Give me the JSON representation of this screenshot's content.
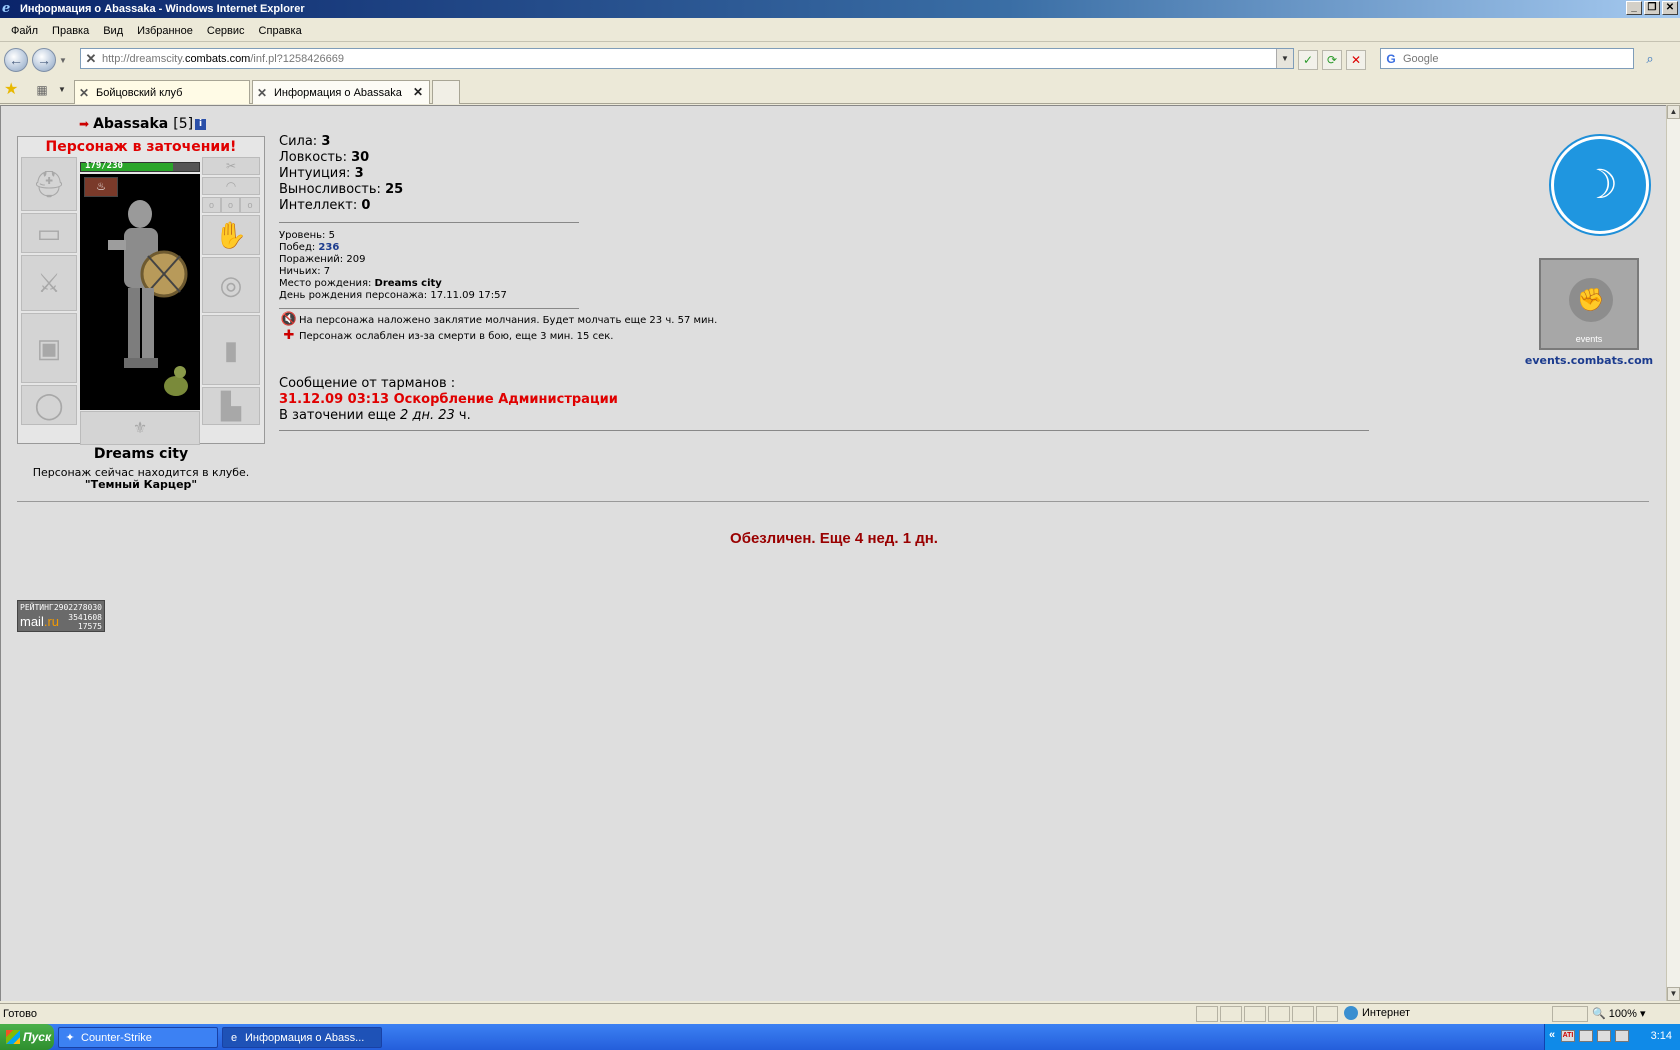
{
  "window": {
    "title": "Информация о Abassaka - Windows Internet Explorer",
    "min": "_",
    "max": "❐",
    "close": "✕"
  },
  "menu": [
    "Файл",
    "Правка",
    "Вид",
    "Избранное",
    "Сервис",
    "Справка"
  ],
  "address": {
    "prefix": "http://dreamscity.",
    "domain": "combats.com",
    "path": "/inf.pl?1258426669"
  },
  "search": {
    "placeholder": "Google"
  },
  "tabs": [
    {
      "label": "Бойцовский клуб"
    },
    {
      "label": "Информация о Abassaka"
    }
  ],
  "character": {
    "nick": "Abassaka",
    "level": "[5]",
    "jail_title": "Персонаж в заточении!",
    "hp_text": "179/230",
    "hp_fraction": 0.778,
    "city": "Dreams city",
    "location_text": "Персонаж сейчас находится в клубе.",
    "room": "\"Темный Карцер\""
  },
  "stats": [
    {
      "label": "Сила: ",
      "value": "3"
    },
    {
      "label": "Ловкость: ",
      "value": "30"
    },
    {
      "label": "Интуиция: ",
      "value": "3"
    },
    {
      "label": "Выносливость: ",
      "value": "25"
    },
    {
      "label": "Интеллект: ",
      "value": "0"
    }
  ],
  "details": {
    "level_label": "Уровень: ",
    "level": "5",
    "wins_label": "Побед: ",
    "wins": "236",
    "losses_label": "Поражений: ",
    "losses": "209",
    "draws_label": "Ничьих: ",
    "draws": "7",
    "birthplace_label": "Место рождения: ",
    "birthplace": "Dreams city",
    "birthday_label": "День рождения персонажа: ",
    "birthday": "17.11.09 17:57"
  },
  "effects": [
    "На персонажа наложено заклятие молчания. Будет молчать еще 23 ч. 57 мин.",
    "Персонаж ослаблен из-за смерти в бою, еще 3 мин. 15 сек."
  ],
  "message": {
    "title": "Сообщение от тарманов :",
    "text": "31.12.09 03:13 Оскорбление Администрации",
    "jail_prefix": "В заточении еще ",
    "jail_time": "2 дн. 23",
    "jail_suffix": " ч."
  },
  "events": {
    "link": "events.combats.com",
    "badge": "events"
  },
  "depersonalized": "Обезличен. Еще 4 нед. 1 дн.",
  "counter": {
    "label": "РЕЙТИНГ",
    "n1": "2902278030",
    "brand_a": "mail",
    "brand_b": ".ru",
    "n2": "3541608",
    "n3": "17575"
  },
  "status": {
    "text": "Готово",
    "zone": "Интернет",
    "zoom": "100%"
  },
  "taskbar": {
    "start": "Пуск",
    "tasks": [
      "Counter-Strike",
      "Информация о Abass..."
    ],
    "clock": "3:14"
  }
}
